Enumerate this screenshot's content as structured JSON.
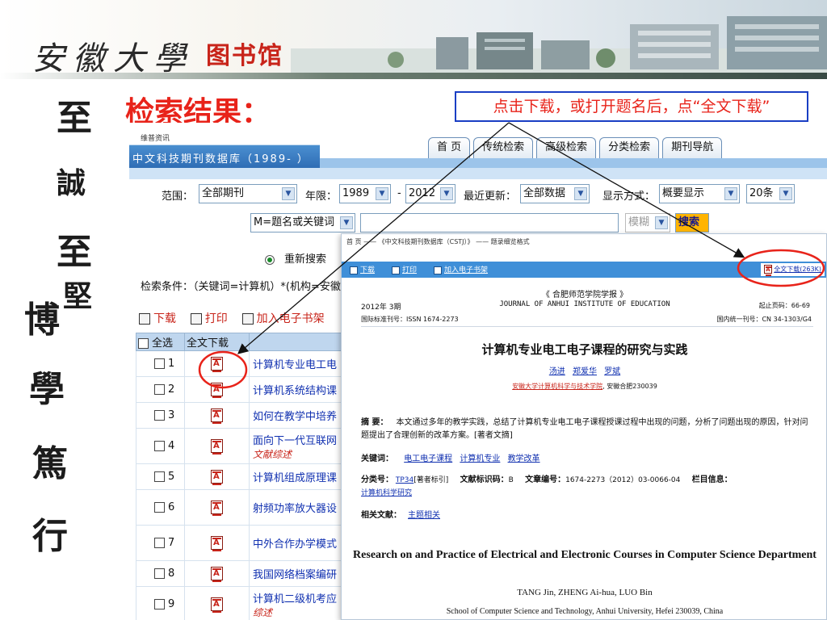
{
  "banner": {
    "calligraphy": "安徽大學",
    "library_name": "图书馆"
  },
  "motto": [
    "至",
    "誠",
    "至",
    "堅",
    "博",
    "學",
    "篤",
    "行"
  ],
  "result_title": "检索结果：",
  "hint": "点击下载，或打开题名后，点“全文下载”",
  "database": {
    "logo_small": "维普资讯",
    "logo_name": "中文科技期刊数据库（1989- ）",
    "nav_tabs": [
      "首  页",
      "传统检索",
      "高级检索",
      "分类检索",
      "期刊导航"
    ],
    "filter": {
      "scope_label": "范围：",
      "scope_value": "全部期刊",
      "year_label": "年限：",
      "year_from": "1989",
      "year_dash": "-",
      "year_to": "2012",
      "update_label": "最近更新：",
      "update_value": "全部数据",
      "display_label": "显示方式：",
      "display_value": "概要显示",
      "count_value": "20条"
    },
    "search_field": "M=题名或关键词",
    "match_value": "模糊",
    "search_button": "搜索",
    "resubmit_label": "重新搜索",
    "condition": "检索条件：（关键词=计算机）*(机构=安徽",
    "actions": {
      "download": "下载",
      "print": "打印",
      "add_shelf": "加入电子书架"
    },
    "table": {
      "col_select_all": "全选",
      "col_fulltext": "全文下载",
      "rows": [
        {
          "num": "1",
          "title": "计算机专业电工电",
          "sub": ""
        },
        {
          "num": "2",
          "title": "计算机系统结构课",
          "sub": ""
        },
        {
          "num": "3",
          "title": "如何在教学中培养",
          "sub": ""
        },
        {
          "num": "4",
          "title": "面向下一代互联网",
          "sub": "文献综述"
        },
        {
          "num": "5",
          "title": "计算机组成原理课",
          "sub": ""
        },
        {
          "num": "6",
          "title": "射频功率放大器设",
          "sub": ""
        },
        {
          "num": "7",
          "title": "中外合作办学模式",
          "sub": ""
        },
        {
          "num": "8",
          "title": "我国网络档案编研",
          "sub": ""
        },
        {
          "num": "9",
          "title": "计算机二级机考应",
          "sub": "综述"
        }
      ]
    }
  },
  "article": {
    "breadcrumb": "首  页  ——  《中文科技期刊数据库（CSTJ）》  ——  题录细览格式",
    "toolbar": {
      "download": "下载",
      "print": "打印",
      "add_shelf": "加入电子书架"
    },
    "fulltext_download": "全文下载(263K)",
    "journal_cn": "《 合肥师范学院学报 》",
    "issue": "2012年 3期",
    "journal_en": "JOURNAL OF ANHUI INSTITUTE OF EDUCATION",
    "start_page": "起止页码：66-69",
    "issn": "国际标准刊号：ISSN 1674-2273",
    "cn": "国内统一刊号：CN 34-1303/G4",
    "title": "计算机专业电工电子课程的研究与实践",
    "authors": [
      "汤进",
      "郑爱华",
      "罗斌"
    ],
    "affiliation_link": "安徽大学计算机科学与技术学院",
    "affiliation_rest": ", 安徽合肥230039",
    "abstract_label": "摘  要：",
    "abstract_text": "本文通过多年的教学实践，总结了计算机专业电工电子课程授课过程中出现的问题，分析了问题出现的原因，针对问题提出了合理创新的改革方案。[著者文摘]",
    "keywords_label": "关键词：",
    "keywords": [
      "电工电子课程",
      "计算机专业",
      "教学改革"
    ],
    "class_label": "分类号：",
    "class_value": "TP34",
    "class_note": "[著者标引]",
    "doc_code_label": "文献标识码：",
    "doc_code": "B",
    "article_no_label": "文章编号：",
    "article_no": "1674-2273（2012）03-0066-04",
    "column_label": "栏目信息：",
    "column_value": "计算机科学研究",
    "related_label": "相关文献：",
    "related_value": "主题相关",
    "en_title": "Research on and Practice of Electrical and Electronic Courses in Computer Science Department",
    "en_authors": "TANG Jin, ZHENG Ai-hua, LUO Bin",
    "en_affiliation": "School of Computer Science and Technology, Anhui University, Hefei 230039, China"
  },
  "colors": {
    "accent_red": "#e8231a",
    "hint_border": "#1a3ec4",
    "toolbar_blue": "#3f8fd8",
    "link_blue": "#1030b0"
  }
}
